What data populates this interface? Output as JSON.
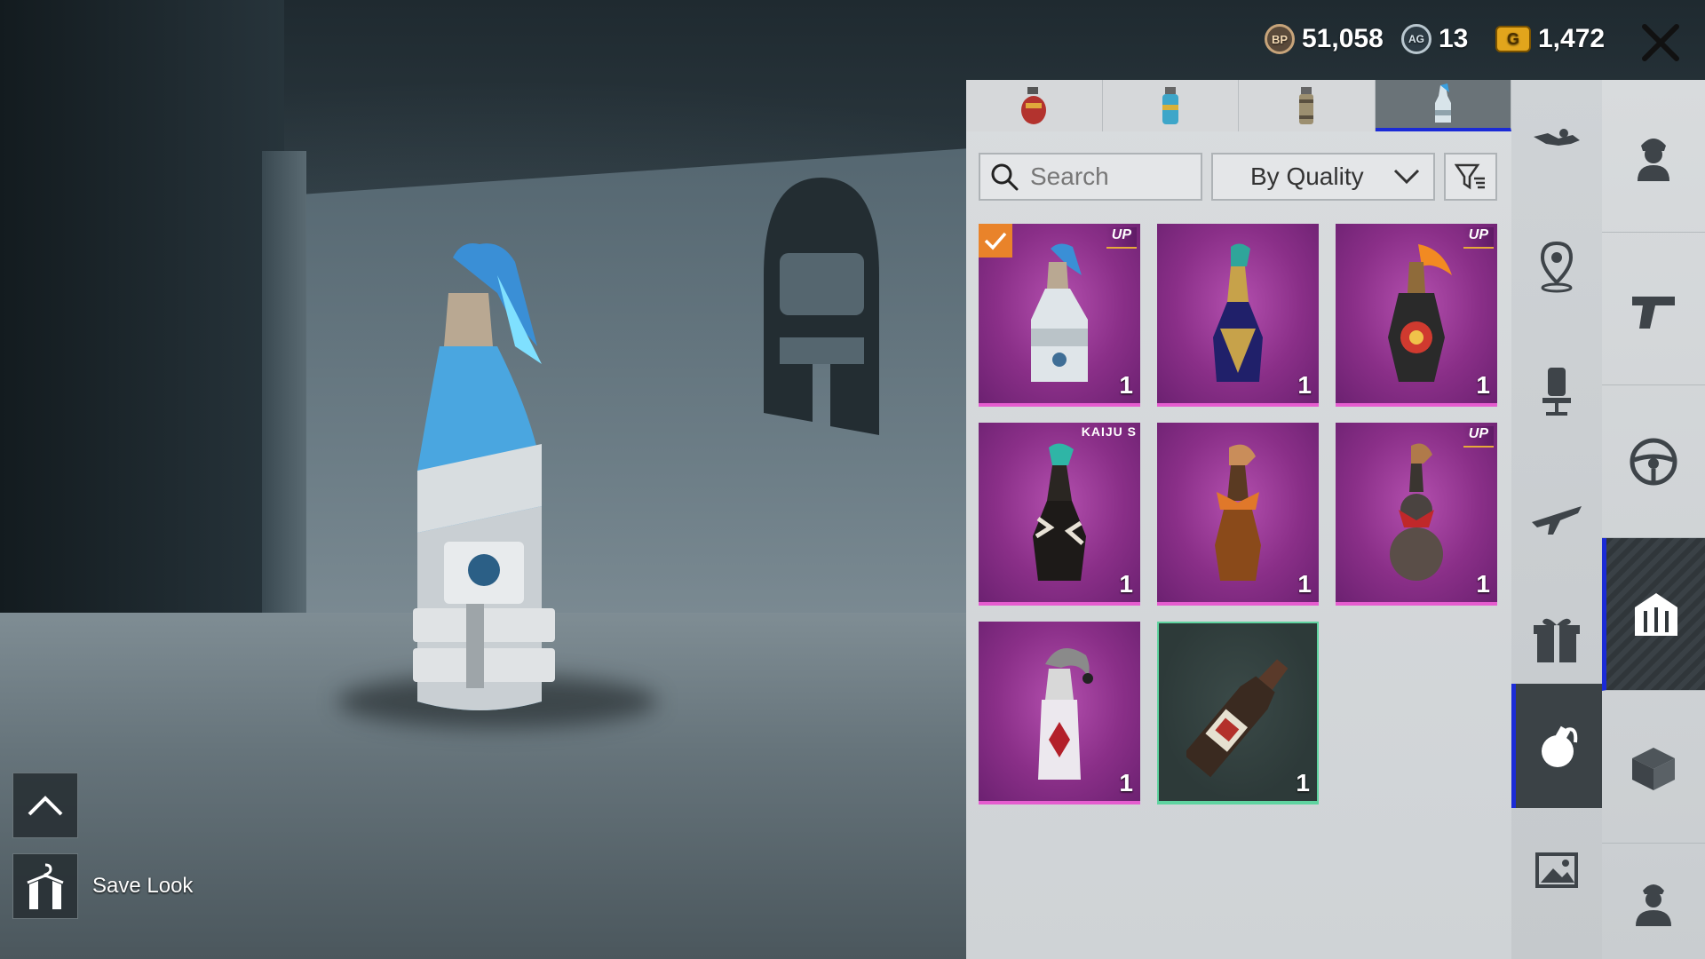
{
  "currency": {
    "bp": {
      "icon": "bp-coin-icon",
      "label": "BP",
      "value": "51,058"
    },
    "ag": {
      "icon": "ag-coin-icon",
      "label": "AG",
      "value": "13"
    },
    "uc": {
      "icon": "g-coin-icon",
      "label": "G",
      "value": "1,472"
    }
  },
  "tabs": [
    {
      "icon": "frag-grenade-tab-icon",
      "active": false
    },
    {
      "icon": "smoke-grenade-tab-icon",
      "active": false
    },
    {
      "icon": "stun-grenade-tab-icon",
      "active": false
    },
    {
      "icon": "molotov-tab-icon",
      "active": true
    }
  ],
  "search": {
    "placeholder": "Search"
  },
  "sort": {
    "selected": "By Quality"
  },
  "items": [
    {
      "name": "ice-skull-molotov",
      "count": "1",
      "badge": "UP",
      "equipped": true,
      "rarity": "epic"
    },
    {
      "name": "navy-gold-molotov",
      "count": "1",
      "badge": "",
      "equipped": false,
      "rarity": "epic"
    },
    {
      "name": "lantern-molotov",
      "count": "1",
      "badge": "UP",
      "equipped": false,
      "rarity": "epic"
    },
    {
      "name": "kaiju-molotov",
      "count": "1",
      "badge": "KAIJU S",
      "equipped": false,
      "rarity": "epic"
    },
    {
      "name": "bow-bottle-molotov",
      "count": "1",
      "badge": "",
      "equipped": false,
      "rarity": "epic"
    },
    {
      "name": "gourd-molotov",
      "count": "1",
      "badge": "UP",
      "equipped": false,
      "rarity": "epic"
    },
    {
      "name": "jester-molotov",
      "count": "1",
      "badge": "",
      "equipped": false,
      "rarity": "epic"
    },
    {
      "name": "classic-molotov",
      "count": "1",
      "badge": "",
      "equipped": false,
      "rarity": "classic"
    }
  ],
  "save_look": {
    "label": "Save Look"
  },
  "colors": {
    "accent": "#1b2bd6",
    "epic": "#8a2f88",
    "equipped": "#e9832a",
    "classic_border": "#5fd3a0"
  }
}
